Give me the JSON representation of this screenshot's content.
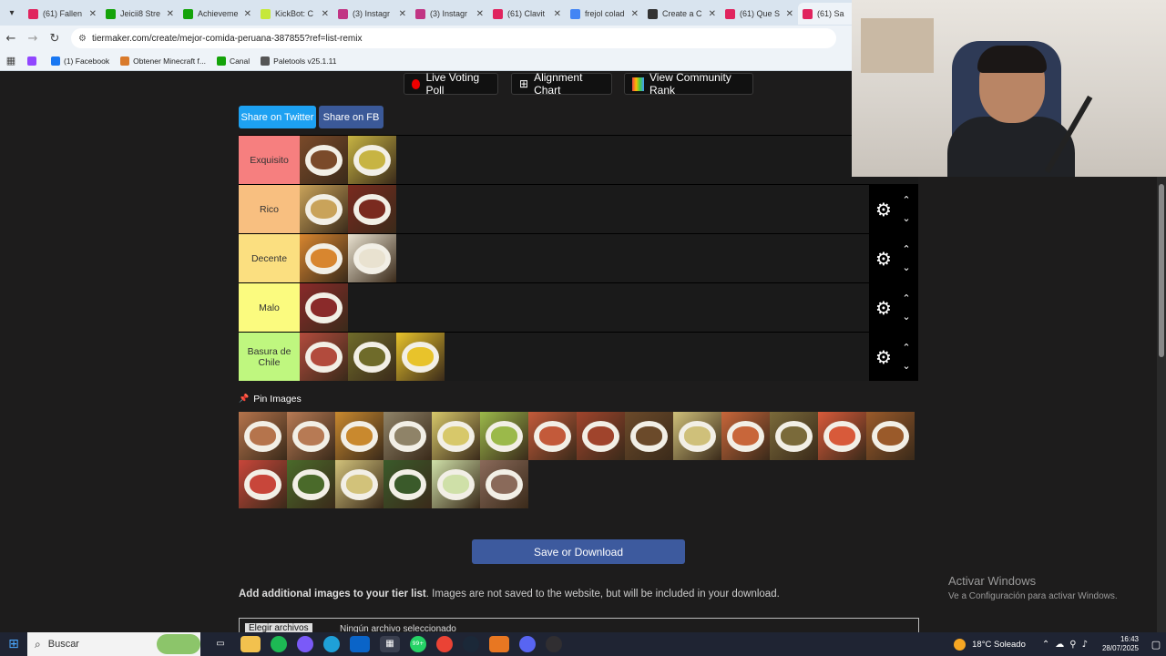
{
  "browser": {
    "tabs": [
      {
        "title": "(61) Fallen",
        "color": "#e0245e"
      },
      {
        "title": "Jeicii8 Stre",
        "color": "#15a30a"
      },
      {
        "title": "Achieveme",
        "color": "#15a30a"
      },
      {
        "title": "KickBot: C",
        "color": "#c6e83a"
      },
      {
        "title": "(3) Instagr",
        "color": "#c13584"
      },
      {
        "title": "(3) Instagr",
        "color": "#c13584"
      },
      {
        "title": "(61) Clavit",
        "color": "#e0245e"
      },
      {
        "title": "frejol colad",
        "color": "#4285f4"
      },
      {
        "title": "Create a C",
        "color": "#333333"
      },
      {
        "title": "(61) Que S",
        "color": "#e0245e"
      },
      {
        "title": "(61) Sa",
        "color": "#e0245e"
      }
    ],
    "url": "tiermaker.com/create/mejor-comida-peruana-387855?ref=list-remix",
    "bookmarks": [
      {
        "label": "",
        "color": "#9146ff"
      },
      {
        "label": "(1) Facebook",
        "color": "#1877f2"
      },
      {
        "label": "Obtener Minecraft f...",
        "color": "#d97a2b"
      },
      {
        "label": "Canal",
        "color": "#15a30a"
      },
      {
        "label": "Paletools v25.1.11",
        "color": "#555555"
      }
    ]
  },
  "page": {
    "buttons": {
      "live_poll": "Live Voting Poll",
      "alignment": "Alignment Chart",
      "community": "View Community Rank",
      "twitter": "Share on Twitter",
      "fb": "Share on FB"
    },
    "tiers": [
      {
        "label": "Exquisito",
        "color": "#f67f7f",
        "items": [
          "#7a4a2a",
          "#c7b443"
        ]
      },
      {
        "label": "Rico",
        "color": "#f8bf80",
        "items": [
          "#c9a35a",
          "#7a2a1f"
        ]
      },
      {
        "label": "Decente",
        "color": "#fbdf80",
        "items": [
          "#d8862f",
          "#e9e2d0"
        ]
      },
      {
        "label": "Malo",
        "color": "#fbfb7f",
        "items": [
          "#8a2a2a"
        ]
      },
      {
        "label": "Basura de Chile",
        "color": "#bff77f",
        "items": [
          "#b24b3d",
          "#6f6b2a",
          "#e8c32b"
        ]
      }
    ],
    "pin_images": "Pin Images",
    "pool": [
      "#b5744c",
      "#b77a54",
      "#c9892e",
      "#8f8368",
      "#d7c86a",
      "#9bb94a",
      "#c35a3a",
      "#a0442c",
      "#6b4a2a",
      "#cfc07a",
      "#c8663a",
      "#7a6a3a",
      "#d85a3a",
      "#9a5a2a",
      "#c8463a",
      "#4a6a2a",
      "#d2c27a",
      "#3a5a2a",
      "#cfe0a8",
      "#8a6a5a"
    ],
    "save_button": "Save or Download",
    "add_images_bold": "Add additional images to your tier list",
    "add_images_rest": ". Images are not saved to the website, but will be included in your download.",
    "file_button": "Elegir archivos",
    "file_none": "Ningún archivo seleccionado"
  },
  "windows": {
    "activate_title": "Activar Windows",
    "activate_sub": "Ve a Configuración para activar Windows."
  },
  "taskbar": {
    "search": "Buscar",
    "weather": "18°C  Soleado",
    "time": "16:43",
    "date": "28/07/2025",
    "badge": "99+"
  }
}
